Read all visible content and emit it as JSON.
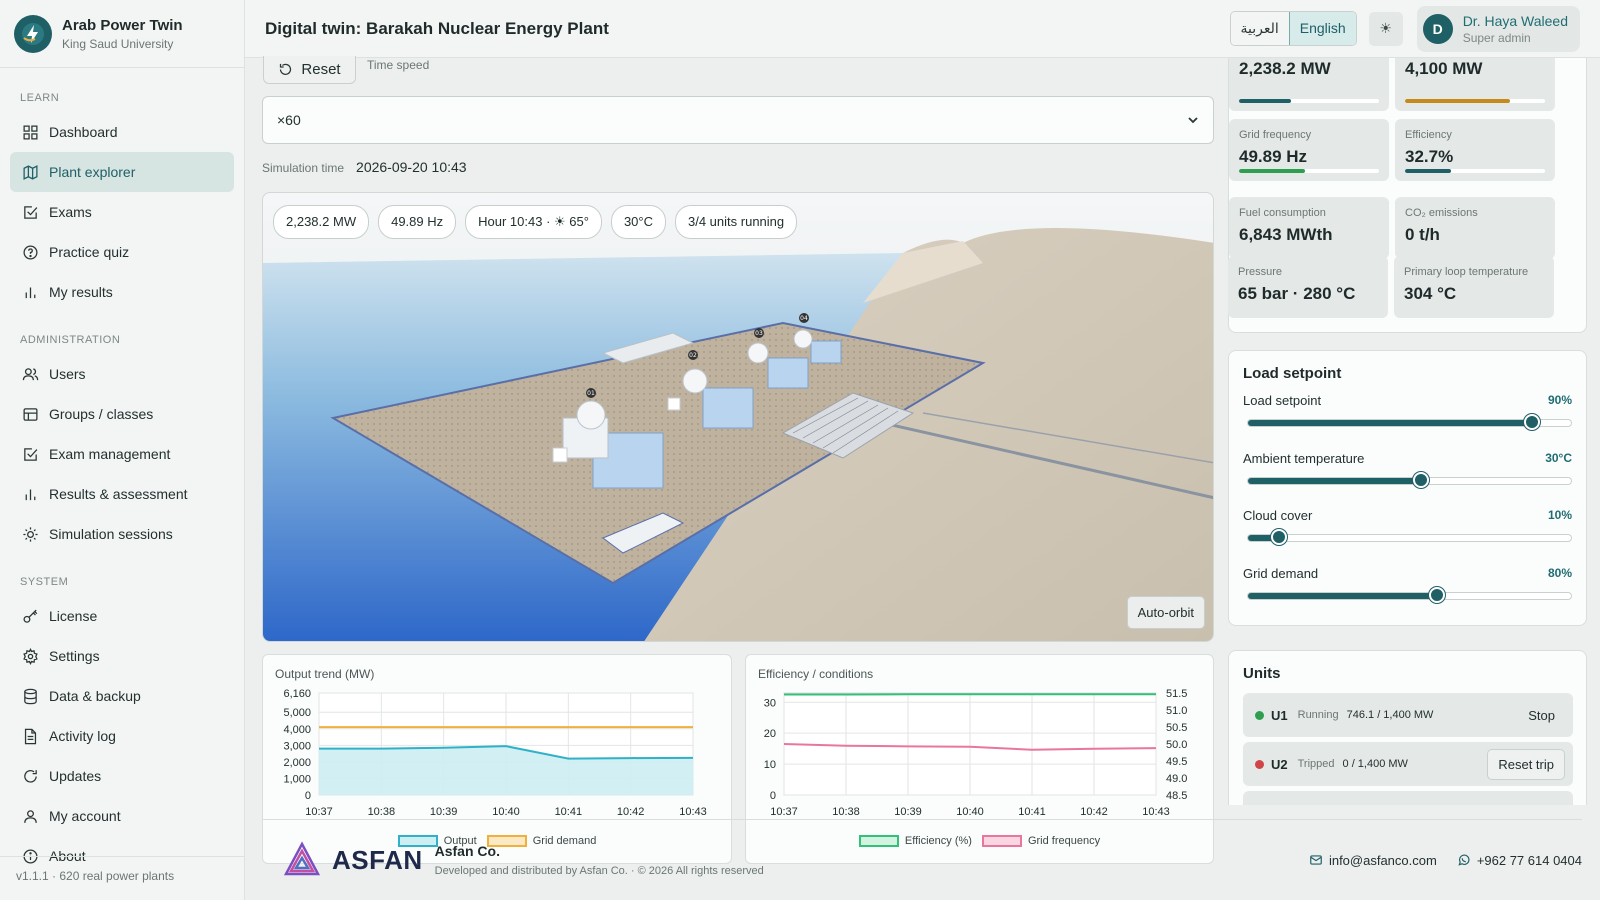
{
  "brand": {
    "name": "Arab Power Twin",
    "subtitle": "King Saud University"
  },
  "sidebar": {
    "sections": [
      {
        "label": "LEARN"
      },
      {
        "label": "ADMINISTRATION"
      },
      {
        "label": "SYSTEM"
      }
    ],
    "items": [
      {
        "label": "Dashboard",
        "icon": "grid-icon"
      },
      {
        "label": "Plant explorer",
        "icon": "map-icon",
        "active": true
      },
      {
        "label": "Exams",
        "icon": "checkbox-icon"
      },
      {
        "label": "Practice quiz",
        "icon": "question-icon"
      },
      {
        "label": "My results",
        "icon": "bar-chart-icon"
      },
      {
        "label": "Users",
        "icon": "users-icon"
      },
      {
        "label": "Groups / classes",
        "icon": "table-icon"
      },
      {
        "label": "Exam management",
        "icon": "checkbox-icon"
      },
      {
        "label": "Results & assessment",
        "icon": "bar-chart-icon"
      },
      {
        "label": "Simulation sessions",
        "icon": "sun-icon"
      },
      {
        "label": "License",
        "icon": "key-icon"
      },
      {
        "label": "Settings",
        "icon": "gear-icon"
      },
      {
        "label": "Data & backup",
        "icon": "database-icon"
      },
      {
        "label": "Activity log",
        "icon": "document-icon"
      },
      {
        "label": "Updates",
        "icon": "refresh-icon"
      },
      {
        "label": "My account",
        "icon": "user-icon"
      },
      {
        "label": "About",
        "icon": "info-icon"
      }
    ],
    "footer": "v1.1.1 · 620 real power plants"
  },
  "header": {
    "title": "Digital twin: Barakah Nuclear Energy Plant",
    "lang_ar": "العربية",
    "lang_en": "English",
    "theme_icon": "☀",
    "user": {
      "initial": "D",
      "name": "Dr. Haya Waleed",
      "role": "Super admin"
    }
  },
  "controls": {
    "reset_label": "Reset",
    "time_speed_label": "Time speed",
    "time_speed_value": "×60",
    "sim_time_label": "Simulation time",
    "sim_time_value": "2026-09-20 10:43"
  },
  "viewport": {
    "pills": [
      "2,238.2 MW",
      "49.89 Hz",
      "Hour 10:43 · ☀ 65°",
      "30°C",
      "3/4 units running"
    ],
    "auto_orbit": "Auto-orbit",
    "unit_tags": [
      "01",
      "02",
      "03",
      "04"
    ]
  },
  "kpis": [
    {
      "label": "",
      "value": "2,238.2 MW",
      "fill": 0.37,
      "color": "#1f5f66"
    },
    {
      "label": "",
      "value": "4,100 MW",
      "fill": 0.75,
      "color": "#c48a1c"
    },
    {
      "label": "Grid frequency",
      "value": "49.89 Hz",
      "fill": 0.47,
      "color": "#2e9f4f"
    },
    {
      "label": "Efficiency",
      "value": "32.7%",
      "fill": 0.33,
      "color": "#1f5f66"
    },
    {
      "label": "Fuel consumption",
      "value": "6,843 MWth"
    },
    {
      "label": "CO₂ emissions",
      "value": "0 t/h"
    },
    {
      "label": "Pressure",
      "value": "65 bar · 280 °C"
    },
    {
      "label": "Primary loop temperature",
      "value": "304 °C"
    }
  ],
  "setpoints": {
    "title": "Load setpoint",
    "sliders": [
      {
        "label": "Load setpoint",
        "display": "90%",
        "value": 0.9
      },
      {
        "label": "Ambient temperature",
        "display": "30°C",
        "value": 0.55
      },
      {
        "label": "Cloud cover",
        "display": "10%",
        "value": 0.1
      },
      {
        "label": "Grid demand",
        "display": "80%",
        "value": 0.6
      }
    ]
  },
  "units": {
    "title": "Units",
    "rows": [
      {
        "id": "U1",
        "status": "Running",
        "output": "746.1 / 1,400 MW",
        "action": "Stop",
        "color": "#2e9f4f"
      },
      {
        "id": "U2",
        "status": "Tripped",
        "output": "0 / 1,400 MW",
        "action": "Reset trip",
        "color": "#d04545"
      }
    ]
  },
  "chart_data": [
    {
      "type": "area",
      "title": "Output trend (MW)",
      "x": [
        "10:37",
        "10:38",
        "10:39",
        "10:40",
        "10:41",
        "10:42",
        "10:43"
      ],
      "ylim": [
        0,
        6160
      ],
      "yticks": [
        "6,160",
        "5,000",
        "4,000",
        "3,000",
        "2,000",
        "1,000",
        "0"
      ],
      "ytick_values": [
        6160,
        5000,
        4000,
        3000,
        2000,
        1000,
        0
      ],
      "series": [
        {
          "name": "Output",
          "values": [
            2800,
            2800,
            2850,
            2950,
            2200,
            2230,
            2240
          ],
          "color": "#2fb1c7"
        },
        {
          "name": "Grid demand",
          "values": [
            4100,
            4100,
            4100,
            4100,
            4100,
            4100,
            4100
          ],
          "color": "#f0b13c"
        }
      ]
    },
    {
      "type": "line",
      "title": "Efficiency / conditions",
      "x": [
        "10:37",
        "10:38",
        "10:39",
        "10:40",
        "10:41",
        "10:42",
        "10:43"
      ],
      "ylim_left": [
        0,
        33
      ],
      "yticks_left": [
        "30",
        "20",
        "10",
        "0"
      ],
      "ytick_values_left": [
        30,
        20,
        10,
        0
      ],
      "ylim_right": [
        48.5,
        51.5
      ],
      "yticks_right": [
        "51.5",
        "51.0",
        "50.5",
        "50.0",
        "49.5",
        "49.0",
        "48.5"
      ],
      "ytick_values_right": [
        51.5,
        51.0,
        50.5,
        50.0,
        49.5,
        49.0,
        48.5
      ],
      "series": [
        {
          "name": "Efficiency (%)",
          "axis": "left",
          "values": [
            32.5,
            32.5,
            32.6,
            32.6,
            32.6,
            32.6,
            32.6
          ],
          "color": "#35c07a"
        },
        {
          "name": "Grid frequency",
          "axis": "right",
          "values": [
            50.0,
            49.95,
            49.93,
            49.92,
            49.83,
            49.86,
            49.88
          ],
          "color": "#e8769e"
        }
      ]
    }
  ],
  "footer": {
    "brand": "ASFAN",
    "company": "Asfan Co.",
    "note": "Developed and distributed by Asfan Co. · © 2026 All rights reserved",
    "email": "info@asfanco.com",
    "phone": "+962 77 614 0404"
  }
}
